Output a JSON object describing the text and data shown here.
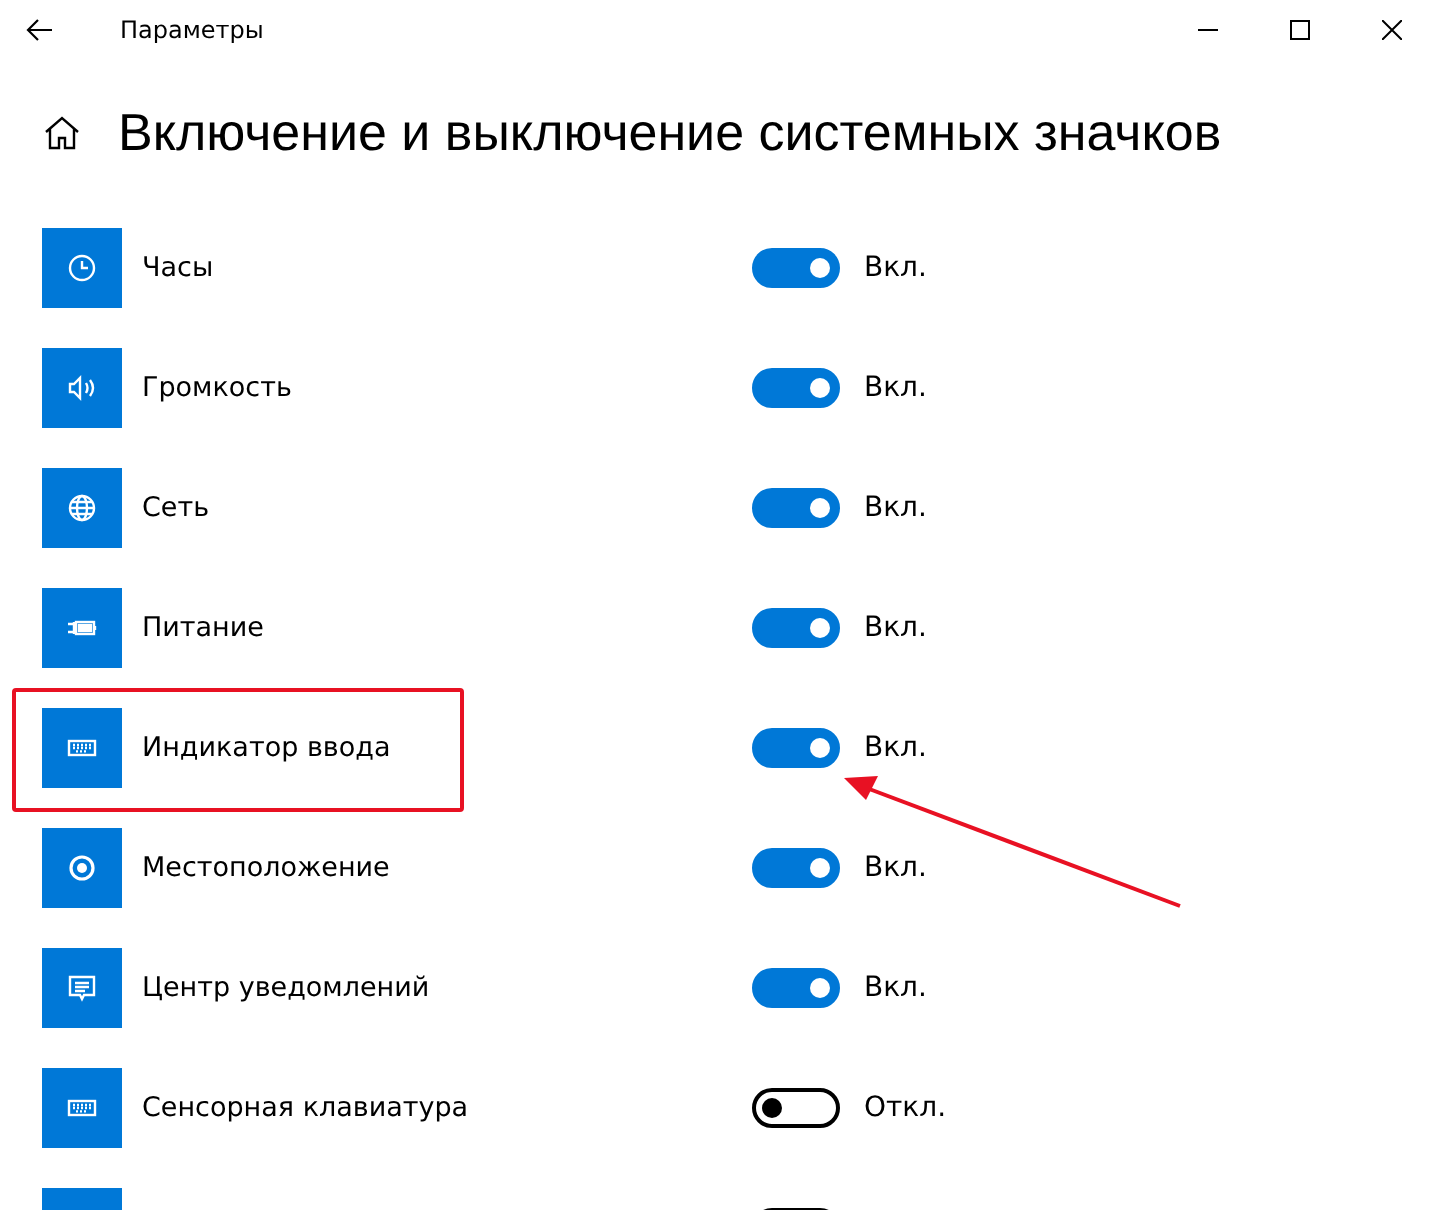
{
  "window": {
    "title": "Параметры"
  },
  "heading": "Включение и выключение системных значков",
  "items": [
    {
      "kind": "clock",
      "label": "Часы",
      "on": true,
      "state_text": "Вкл.",
      "highlighted": false
    },
    {
      "kind": "volume",
      "label": "Громкость",
      "on": true,
      "state_text": "Вкл.",
      "highlighted": false
    },
    {
      "kind": "globe",
      "label": "Сеть",
      "on": true,
      "state_text": "Вкл.",
      "highlighted": false
    },
    {
      "kind": "battery",
      "label": "Питание",
      "on": true,
      "state_text": "Вкл.",
      "highlighted": false
    },
    {
      "kind": "keyboard",
      "label": "Индикатор ввода",
      "on": true,
      "state_text": "Вкл.",
      "highlighted": true
    },
    {
      "kind": "location",
      "label": "Местоположение",
      "on": true,
      "state_text": "Вкл.",
      "highlighted": false
    },
    {
      "kind": "message",
      "label": "Центр уведомлений",
      "on": true,
      "state_text": "Вкл.",
      "highlighted": false
    },
    {
      "kind": "keyboard",
      "label": "Сенсорная клавиатура",
      "on": false,
      "state_text": "Откл.",
      "highlighted": false
    },
    {
      "kind": "none",
      "on": false,
      "highlighted": false
    }
  ]
}
